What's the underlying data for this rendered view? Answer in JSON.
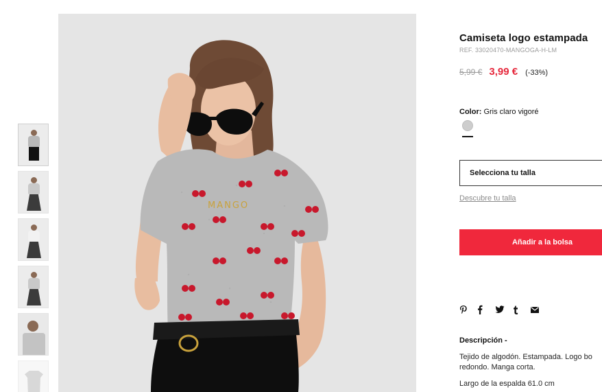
{
  "product": {
    "title": "Camiseta logo estampada",
    "ref": "REF. 33020470-MANGOGA-H-LM",
    "old_price": "5,99 €",
    "new_price": "3,99 €",
    "discount": "(-33%)",
    "color_label": "Color:",
    "color_value": "Gris claro vigoré",
    "size_select": "Selecciona tu talla",
    "size_guide": "Descubre tu talla",
    "add_to_bag": "Añadir a la bolsa",
    "description_title": "Descripción -",
    "description_line1": "Tejido de algodón. Estampada. Logo bo",
    "description_line2": "redondo. Manga corta.",
    "measure": "Largo de la espalda 61.0 cm"
  },
  "image": {
    "shirt_print": "MANGO"
  },
  "share": [
    {
      "name": "pinterest-icon"
    },
    {
      "name": "facebook-icon"
    },
    {
      "name": "twitter-icon"
    },
    {
      "name": "tumblr-icon"
    },
    {
      "name": "email-icon"
    }
  ],
  "colors": {
    "accent": "#f0283c",
    "sale_price": "#e6283c",
    "swatch": "#cdcdcd"
  }
}
